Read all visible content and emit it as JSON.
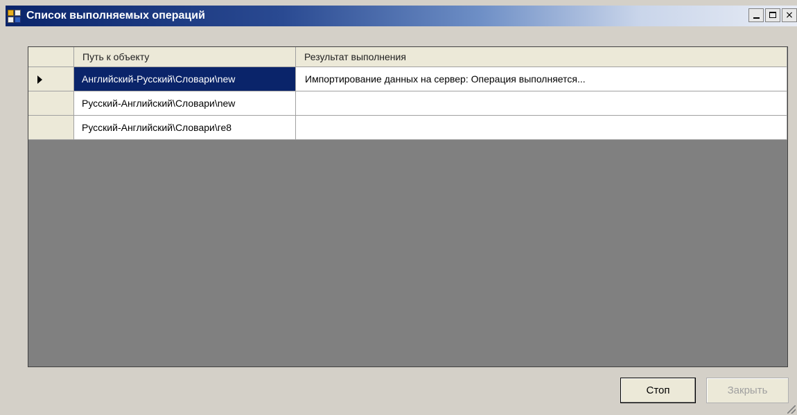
{
  "window": {
    "title": "Список выполняемых операций",
    "caption_buttons": {
      "minimize": "",
      "maximize": "",
      "close": "×"
    }
  },
  "grid": {
    "columns": [
      "",
      "Путь к объекту",
      "Результат выполнения"
    ],
    "rows": [
      {
        "path": "Английский-Русский\\Словари\\new",
        "result": "Импортирование данных на сервер: Операция выполняется...",
        "current": true
      },
      {
        "path": "Русский-Английский\\Словари\\new",
        "result": "",
        "current": false
      },
      {
        "path": "Русский-Английский\\Словари\\ге8",
        "result": "",
        "current": false
      }
    ]
  },
  "buttons": {
    "stop": "Стоп",
    "close": "Закрыть"
  },
  "colors": {
    "title_gradient_start": "#0a246a",
    "selection": "#0a246a",
    "grid_empty_area": "#808080",
    "window_face": "#d4d0c8"
  },
  "icons": {
    "app": "app-grid-icon",
    "row_pointer": "row-pointer-icon"
  }
}
